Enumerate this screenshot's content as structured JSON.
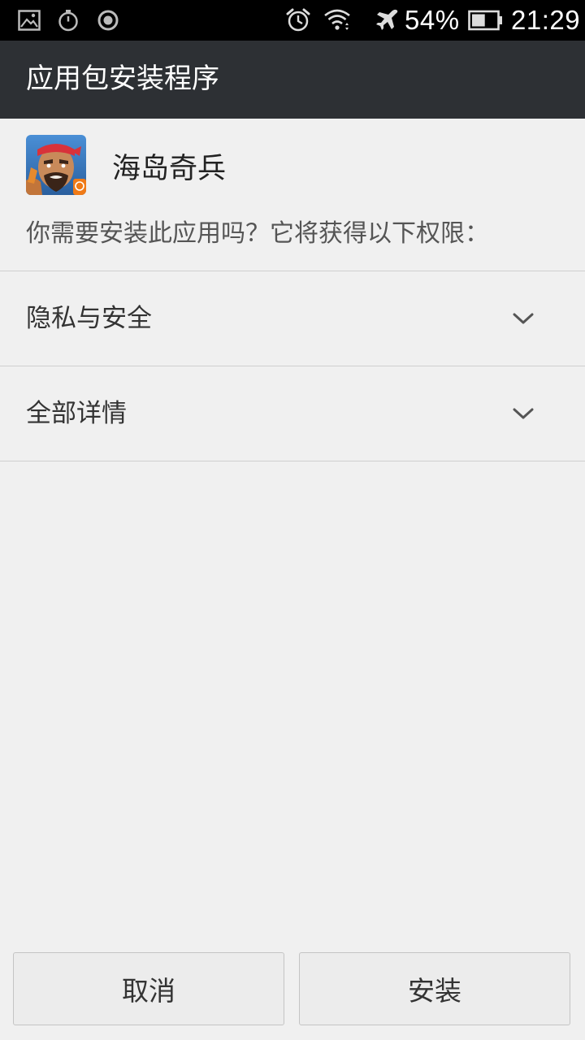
{
  "status_bar": {
    "icons_left": [
      "gallery-icon",
      "stopwatch-icon",
      "record-icon"
    ],
    "icons_right": [
      "alarm-icon",
      "wifi-icon",
      "airplane-icon",
      "battery-icon"
    ],
    "battery": "54%",
    "battery_level": 0.54,
    "time": "21:29"
  },
  "header": {
    "title": "应用包安装程序"
  },
  "app": {
    "name": "海岛奇兵",
    "icon": "app-icon",
    "question": "你需要安装此应用吗？它将获得以下权限："
  },
  "sections": [
    {
      "label": "隐私与安全",
      "icon": "chevron-down-icon"
    },
    {
      "label": "全部详情",
      "icon": "chevron-down-icon"
    }
  ],
  "buttons": {
    "cancel": "取消",
    "install": "安装"
  },
  "colors": {
    "status_bar_bg": "#000000",
    "title_bar_bg": "#2d3034",
    "page_bg": "#f0f0f0",
    "divider": "#cfcfcf"
  }
}
